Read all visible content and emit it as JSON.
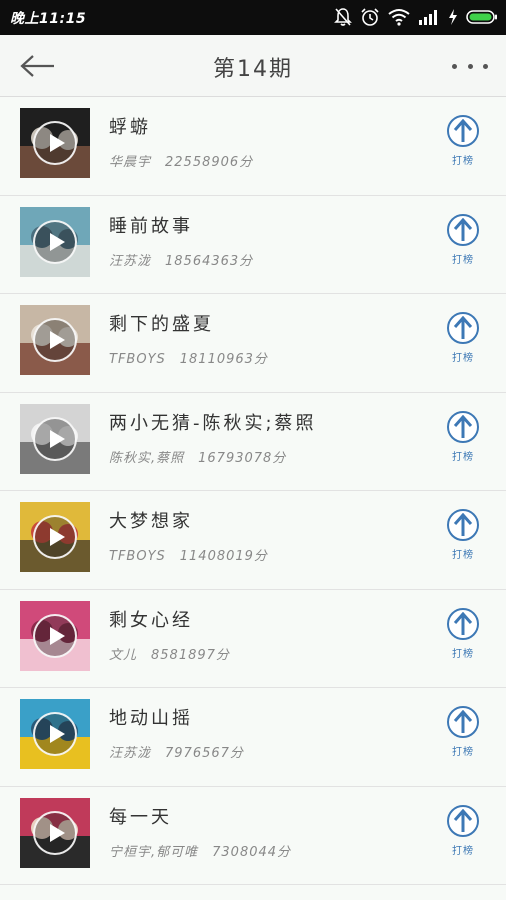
{
  "status_bar": {
    "time": "晚上11:15"
  },
  "header": {
    "title": "第14期"
  },
  "vote_label": "打榜",
  "songs": [
    {
      "title": "蜉蝣",
      "artist": "华晨宇",
      "score": "22558906分",
      "cover_colors": [
        "#1f1f1f",
        "#6b4a3a",
        "#c9c2b8"
      ]
    },
    {
      "title": "睡前故事",
      "artist": "汪苏泷",
      "score": "18564363分",
      "cover_colors": [
        "#6fa7b8",
        "#cfd8d6",
        "#4a6e7e"
      ]
    },
    {
      "title": "剩下的盛夏",
      "artist": "TFBOYS",
      "score": "18110963分",
      "cover_colors": [
        "#c7b7a5",
        "#8a5a4a",
        "#e8e0d6"
      ]
    },
    {
      "title": "两小无猜-陈秋实;蔡照",
      "artist": "陈秋实,蔡照",
      "score": "16793078分",
      "cover_colors": [
        "#d4d4d4",
        "#7a7a7a",
        "#f2f2f2"
      ]
    },
    {
      "title": "大梦想家",
      "artist": "TFBOYS",
      "score": "11408019分",
      "cover_colors": [
        "#e0b93a",
        "#6b5a2e",
        "#c94a3a"
      ]
    },
    {
      "title": "剩女心经",
      "artist": "文儿",
      "score": "8581897分",
      "cover_colors": [
        "#d04a7a",
        "#f0c0d0",
        "#8a2a4a"
      ]
    },
    {
      "title": "地动山摇",
      "artist": "汪苏泷",
      "score": "7976567分",
      "cover_colors": [
        "#3aa0c8",
        "#e8c020",
        "#2a5a7a"
      ]
    },
    {
      "title": "每一天",
      "artist": "宁桓宇,郁可唯",
      "score": "7308044分",
      "cover_colors": [
        "#c03a5a",
        "#2a2a2a",
        "#e8d0c0"
      ]
    }
  ]
}
